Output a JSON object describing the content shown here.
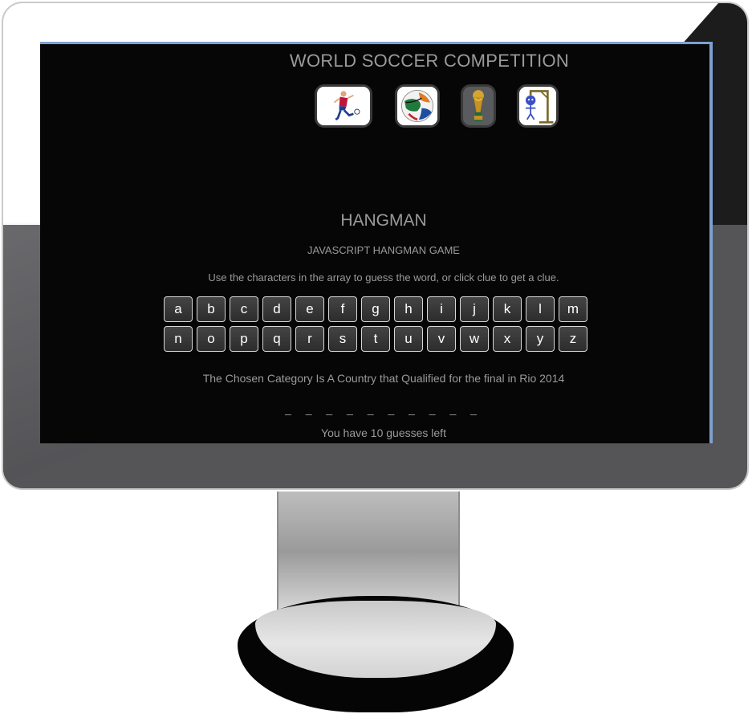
{
  "site": {
    "title": "WORLD SOCCER COMPETITION"
  },
  "nav": {
    "icons": [
      {
        "name": "soccer-player-icon"
      },
      {
        "name": "soccer-ball-icon"
      },
      {
        "name": "world-cup-trophy-icon"
      },
      {
        "name": "hangman-icon"
      }
    ]
  },
  "game": {
    "title": "HANGMAN",
    "subtitle": "JAVASCRIPT HANGMAN GAME",
    "instructions": "Use the characters in the array to guess the word, or click clue to get a clue.",
    "keys_row1": [
      "a",
      "b",
      "c",
      "d",
      "e",
      "f",
      "g",
      "h",
      "i",
      "j",
      "k",
      "l",
      "m"
    ],
    "keys_row2": [
      "n",
      "o",
      "p",
      "q",
      "r",
      "s",
      "t",
      "u",
      "v",
      "w",
      "x",
      "y",
      "z"
    ],
    "category": "The Chosen Category Is A Country that Qualified for the final in Rio 2014",
    "blanks": "_ _ _ _ _ _ _ _ _ _",
    "lives": "You have 10 guesses left"
  },
  "colors": {
    "screen_bg": "#060606",
    "text": "#9a9a9a",
    "screen_border": "#7f9fcf"
  }
}
